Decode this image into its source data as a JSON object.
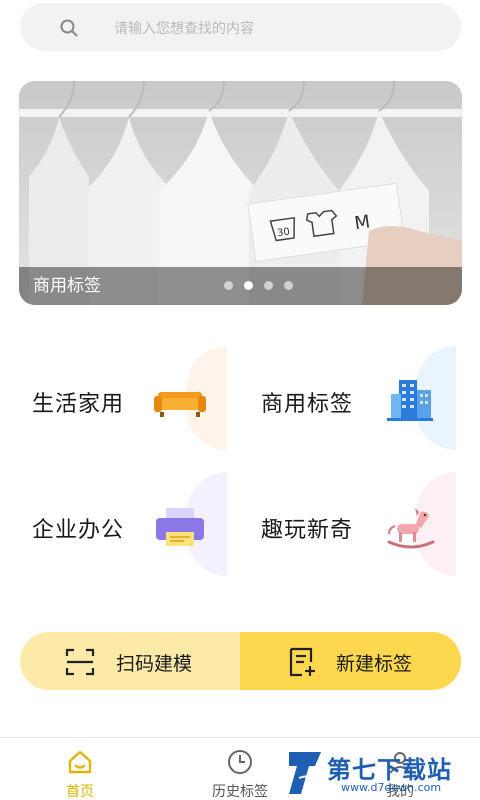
{
  "search": {
    "placeholder": "请输入您想查找的内容",
    "icon": "search-icon"
  },
  "banner": {
    "caption": "商用标签",
    "slide_count": 4,
    "active_slide": 2,
    "tag_size": "M",
    "tag_wash": "30"
  },
  "categories": [
    {
      "label": "生活家用",
      "icon": "sofa-icon"
    },
    {
      "label": "商用标签",
      "icon": "building-icon"
    },
    {
      "label": "企业办公",
      "icon": "printer-icon"
    },
    {
      "label": "趣玩新奇",
      "icon": "rocking-horse-icon"
    }
  ],
  "actions": {
    "scan": {
      "label": "扫码建模",
      "icon": "scan-icon"
    },
    "create": {
      "label": "新建标签",
      "icon": "new-label-icon"
    }
  },
  "tabs": [
    {
      "label": "首页",
      "icon": "home-icon",
      "active": true
    },
    {
      "label": "历史标签",
      "icon": "clock-icon",
      "active": false
    },
    {
      "label": "我的",
      "icon": "user-icon",
      "active": false
    }
  ],
  "watermark": {
    "text": "第七下载站",
    "sub": "www.d7down.com"
  },
  "colors": {
    "accent": "#fdd84f",
    "accent_light": "#fdeaa8",
    "active_tab": "#e0b400",
    "search_bg": "#f2f2f2"
  }
}
